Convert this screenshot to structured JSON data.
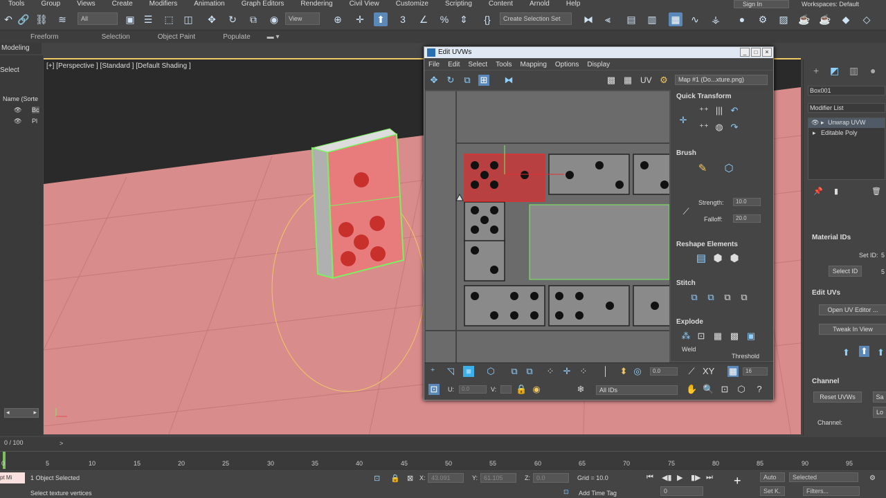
{
  "menubar": {
    "items": [
      "Tools",
      "Group",
      "Views",
      "Create",
      "Modifiers",
      "Animation",
      "Graph Editors",
      "Rendering",
      "Civil View",
      "Customize",
      "Scripting",
      "Content",
      "Arnold",
      "Help"
    ],
    "signin": "Sign In",
    "workspaces": "Workspaces: Default"
  },
  "toolbar": {
    "filter_select": "All",
    "view_select": "View",
    "selection_set": "Create Selection Set"
  },
  "ribbon": {
    "tabs": [
      "Freeform",
      "Selection",
      "Object Paint",
      "Populate"
    ],
    "modeling": "Modeling"
  },
  "left_panel": {
    "select": "Select",
    "name_header": "Name (Sorte",
    "items": [
      "Bc",
      "Pl"
    ]
  },
  "viewport": {
    "label": "[+] [Perspective ] [Standard ] [Default Shading ]",
    "colors": {
      "ground": "#d98c8c",
      "domino": "#e87c7c",
      "pip": "#c8302c",
      "selection": "#7cf060"
    }
  },
  "uvw": {
    "title": "Edit UVWs",
    "menu": [
      "File",
      "Edit",
      "Select",
      "Tools",
      "Mapping",
      "Options",
      "Display"
    ],
    "uv_label": "UV",
    "map_select": "Map #1 (Do...xture.png)",
    "sections": {
      "quick_transform": "Quick Transform",
      "brush": "Brush",
      "strength_label": "Strength:",
      "strength_value": "10.0",
      "falloff_label": "Falloff:",
      "falloff_value": "20.0",
      "reshape": "Reshape Elements",
      "stitch": "Stitch",
      "explode": "Explode",
      "weld": "Weld",
      "threshold": "Threshold"
    },
    "bottom": {
      "value_a": "0.0",
      "xy_label": "XY",
      "value_b": "16",
      "u_label": "U:",
      "u_value": "0.0",
      "v_label": "V:",
      "ids_select": "All IDs"
    }
  },
  "right_panel": {
    "object_name": "Box001",
    "modifier_list": "Modifier List",
    "stack": [
      "Unwrap UVW",
      "Editable Poly"
    ],
    "material_ids": "Material IDs",
    "set_id": "Set ID:",
    "set_id_value": "5",
    "select_id": "Select ID",
    "select_id_value": "5",
    "edit_uvs": "Edit UVs",
    "open_uv_editor": "Open UV Editor ...",
    "tweak_in_view": "Tweak In View",
    "channel": "Channel",
    "reset_uvws": "Reset UVWs",
    "sa": "Sa",
    "lo": "Lo",
    "channel_label": "Channel:"
  },
  "timeline": {
    "frame": "0 / 100",
    "ticks": [
      "0",
      "5",
      "10",
      "15",
      "20",
      "25",
      "30",
      "35",
      "40",
      "45",
      "50",
      "55",
      "60",
      "65",
      "70",
      "75",
      "80",
      "85",
      "90",
      "95"
    ]
  },
  "status": {
    "objects_selected": "1 Object Selected",
    "prompt": "Select texture vertices",
    "x_label": "X:",
    "x_value": "43.091",
    "y_label": "Y:",
    "y_value": "61.105",
    "z_label": "Z:",
    "z_value": "0.0",
    "grid": "Grid = 10.0",
    "add_time_tag": "Add Time Tag",
    "frame_field": "0",
    "auto": "Auto",
    "selected_select": "Selected",
    "set_key": "Set K.",
    "filters": "Filters...",
    "script_mini": "pt Mi"
  }
}
